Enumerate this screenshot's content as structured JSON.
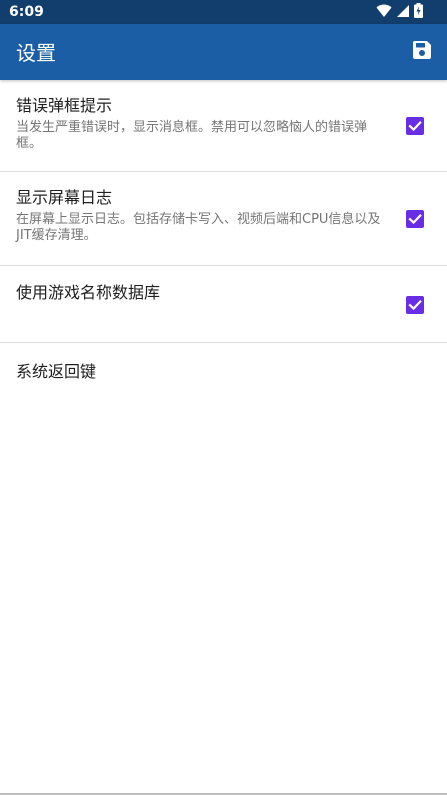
{
  "status_bar": {
    "time": "6:09",
    "icons": [
      "wifi-icon",
      "signal-icon",
      "battery-charging-icon"
    ]
  },
  "app_bar": {
    "title": "设置",
    "action_icon": "save-icon",
    "background": "#1b5ea6"
  },
  "settings": [
    {
      "title": "错误弹框提示",
      "summary": "当发生严重错误时，显示消息框。禁用可以忽略恼人的错误弹框。",
      "checked": true
    },
    {
      "title": "显示屏幕日志",
      "summary": "在屏幕上显示日志。包括存储卡写入、视频后端和CPU信息以及JIT缓存清理。",
      "checked": true
    },
    {
      "title": "使用游戏名称数据库",
      "summary": "",
      "checked": true
    },
    {
      "title": "系统返回键",
      "summary": ""
    }
  ],
  "colors": {
    "status_bar": "#123e6e",
    "checkbox": "#6a2de6"
  }
}
